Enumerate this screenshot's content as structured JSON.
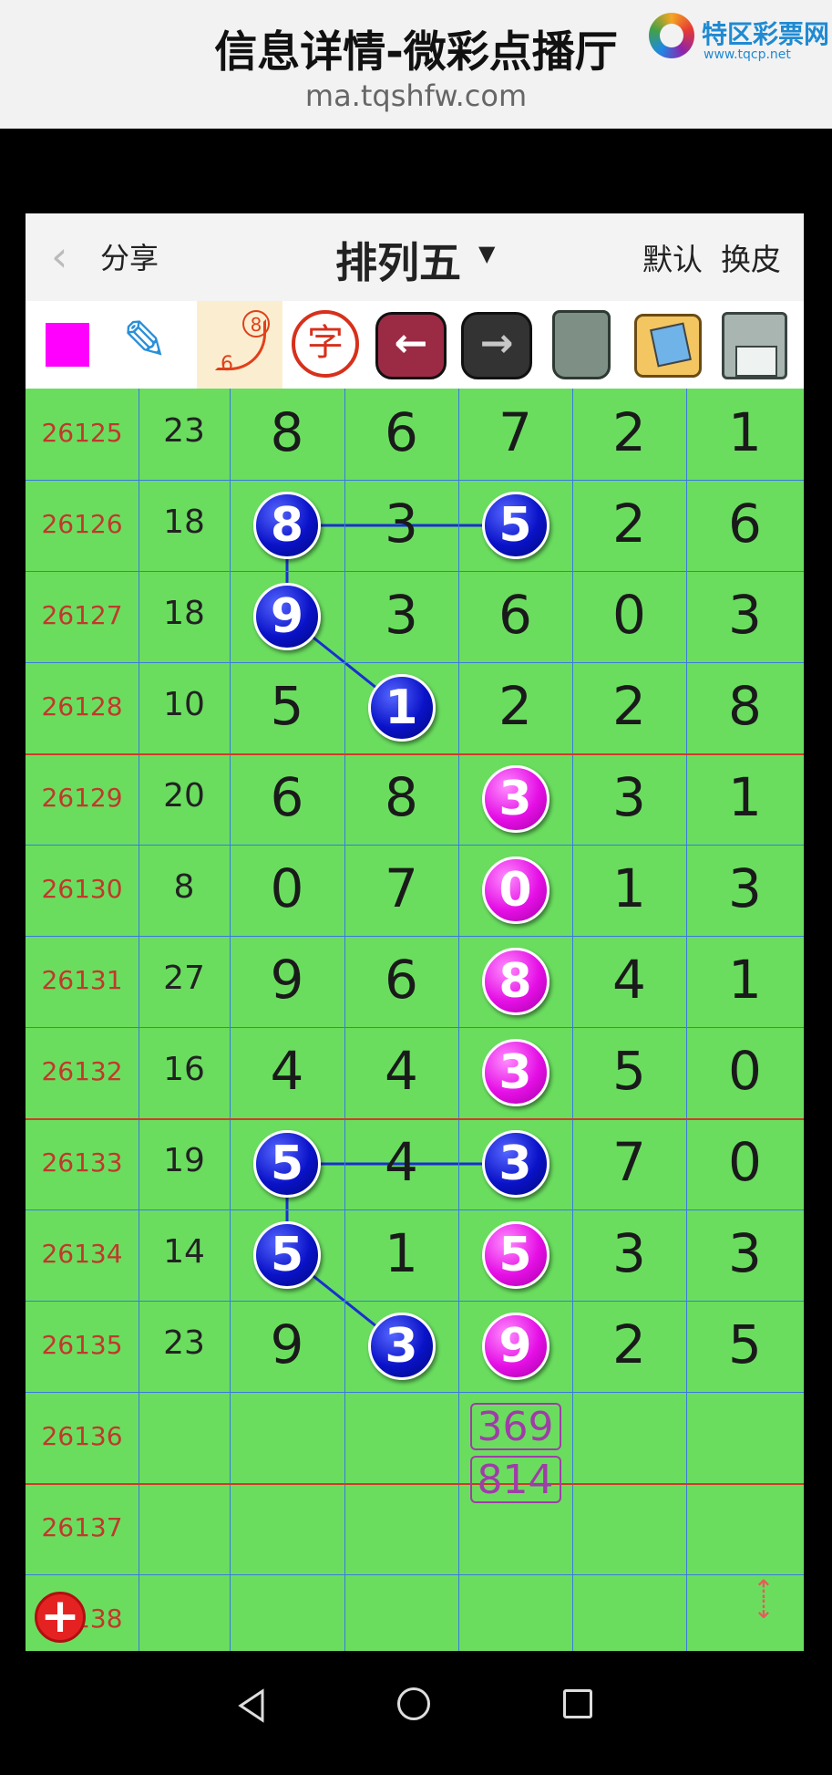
{
  "header": {
    "title": "信息详情-微彩点播厅",
    "url": "ma.tqshfw.com",
    "logo_text": "特区彩票网",
    "logo_sub": "www.tqcp.net"
  },
  "appbar": {
    "share": "分享",
    "title": "排列五",
    "default_label": "默认",
    "skin_label": "换皮"
  },
  "toolbar": {
    "tools": [
      "color-picker",
      "pen",
      "link-numbers",
      "char-tool",
      "prev",
      "next",
      "trash",
      "photo",
      "save"
    ],
    "link_num_top": "8",
    "link_num_bottom": "6",
    "char_label": "字",
    "selected_color": "#ff00ff"
  },
  "table": {
    "rows": [
      {
        "period": "26125",
        "sum": "23",
        "digits": [
          "8",
          "6",
          "7",
          "2",
          "1"
        ]
      },
      {
        "period": "26126",
        "sum": "18",
        "digits": [
          "8",
          "3",
          "5",
          "2",
          "6"
        ]
      },
      {
        "period": "26127",
        "sum": "18",
        "digits": [
          "9",
          "3",
          "6",
          "0",
          "3"
        ]
      },
      {
        "period": "26128",
        "sum": "10",
        "digits": [
          "5",
          "1",
          "2",
          "2",
          "8"
        ]
      },
      {
        "period": "26129",
        "sum": "20",
        "digits": [
          "6",
          "8",
          "3",
          "3",
          "1"
        ]
      },
      {
        "period": "26130",
        "sum": "8",
        "digits": [
          "0",
          "7",
          "0",
          "1",
          "3"
        ]
      },
      {
        "period": "26131",
        "sum": "27",
        "digits": [
          "9",
          "6",
          "8",
          "4",
          "1"
        ]
      },
      {
        "period": "26132",
        "sum": "16",
        "digits": [
          "4",
          "4",
          "3",
          "5",
          "0"
        ]
      },
      {
        "period": "26133",
        "sum": "19",
        "digits": [
          "5",
          "4",
          "3",
          "7",
          "0"
        ]
      },
      {
        "period": "26134",
        "sum": "14",
        "digits": [
          "5",
          "1",
          "5",
          "3",
          "3"
        ]
      },
      {
        "period": "26135",
        "sum": "23",
        "digits": [
          "9",
          "3",
          "9",
          "2",
          "5"
        ]
      },
      {
        "period": "26136",
        "sum": "",
        "digits": [
          "",
          "",
          "",
          "",
          ""
        ]
      },
      {
        "period": "26137",
        "sum": "",
        "digits": [
          "",
          "",
          "",
          "",
          ""
        ]
      },
      {
        "period": "26138",
        "sum": "",
        "digits": [
          "",
          "",
          "",
          "",
          ""
        ]
      }
    ],
    "highlights": [
      {
        "row": 1,
        "col": 0,
        "color": "blue"
      },
      {
        "row": 1,
        "col": 2,
        "color": "blue"
      },
      {
        "row": 2,
        "col": 0,
        "color": "blue"
      },
      {
        "row": 3,
        "col": 1,
        "color": "blue"
      },
      {
        "row": 4,
        "col": 2,
        "color": "magenta"
      },
      {
        "row": 5,
        "col": 2,
        "color": "magenta"
      },
      {
        "row": 6,
        "col": 2,
        "color": "magenta"
      },
      {
        "row": 7,
        "col": 2,
        "color": "magenta"
      },
      {
        "row": 8,
        "col": 0,
        "color": "blue"
      },
      {
        "row": 8,
        "col": 2,
        "color": "blue"
      },
      {
        "row": 9,
        "col": 0,
        "color": "blue"
      },
      {
        "row": 9,
        "col": 2,
        "color": "magenta"
      },
      {
        "row": 10,
        "col": 1,
        "color": "blue"
      },
      {
        "row": 10,
        "col": 2,
        "color": "magenta"
      }
    ],
    "predictions": [
      "369",
      "814"
    ],
    "colors": {
      "grid_bg": "#6add5f",
      "period_text": "#c0392b",
      "blue_ball": "#0a12c8",
      "magenta_ball": "#e50fe5",
      "line": "#3a7ae0"
    }
  }
}
